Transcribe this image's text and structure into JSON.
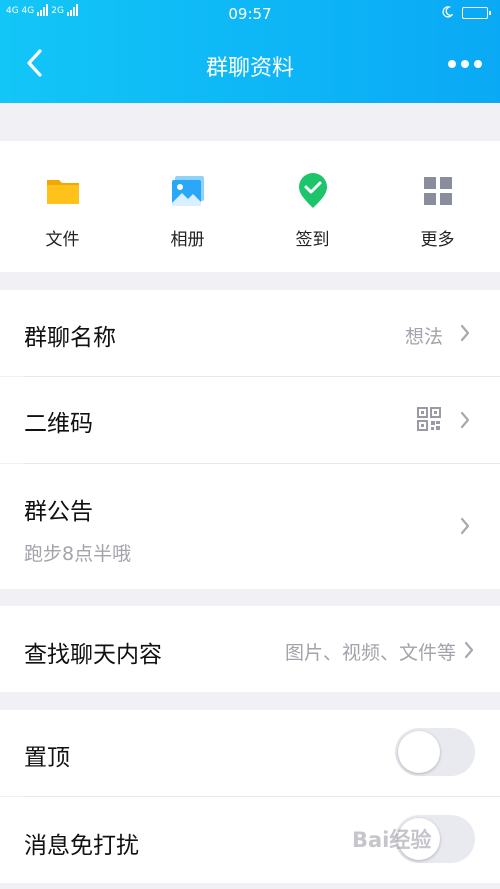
{
  "status_bar": {
    "network_left": "4G 4G",
    "network_right": "2G",
    "time": "09:57"
  },
  "header": {
    "title": "群聊资料"
  },
  "quick_actions": [
    {
      "label": "文件",
      "icon": "folder-icon",
      "color": "#f7b500"
    },
    {
      "label": "相册",
      "icon": "album-icon",
      "color": "#2aa7f7"
    },
    {
      "label": "签到",
      "icon": "check-in-icon",
      "color": "#1cc46c"
    },
    {
      "label": "更多",
      "icon": "grid-icon",
      "color": "#8a8d9c"
    }
  ],
  "settings": {
    "group_name": {
      "label": "群聊名称",
      "value": "想法"
    },
    "qr_code": {
      "label": "二维码"
    },
    "announcement": {
      "label": "群公告",
      "content": "跑步8点半哦"
    },
    "search_chat": {
      "label": "查找聊天内容",
      "hint": "图片、视频、文件等"
    },
    "pin_top": {
      "label": "置顶",
      "enabled": false
    },
    "do_not_disturb": {
      "label": "消息免打扰",
      "enabled": false
    }
  },
  "watermark": "Bai经验",
  "colors": {
    "header_start": "#12c6f7",
    "header_end": "#0aa9f5",
    "chevron": "#a8a8b0"
  }
}
